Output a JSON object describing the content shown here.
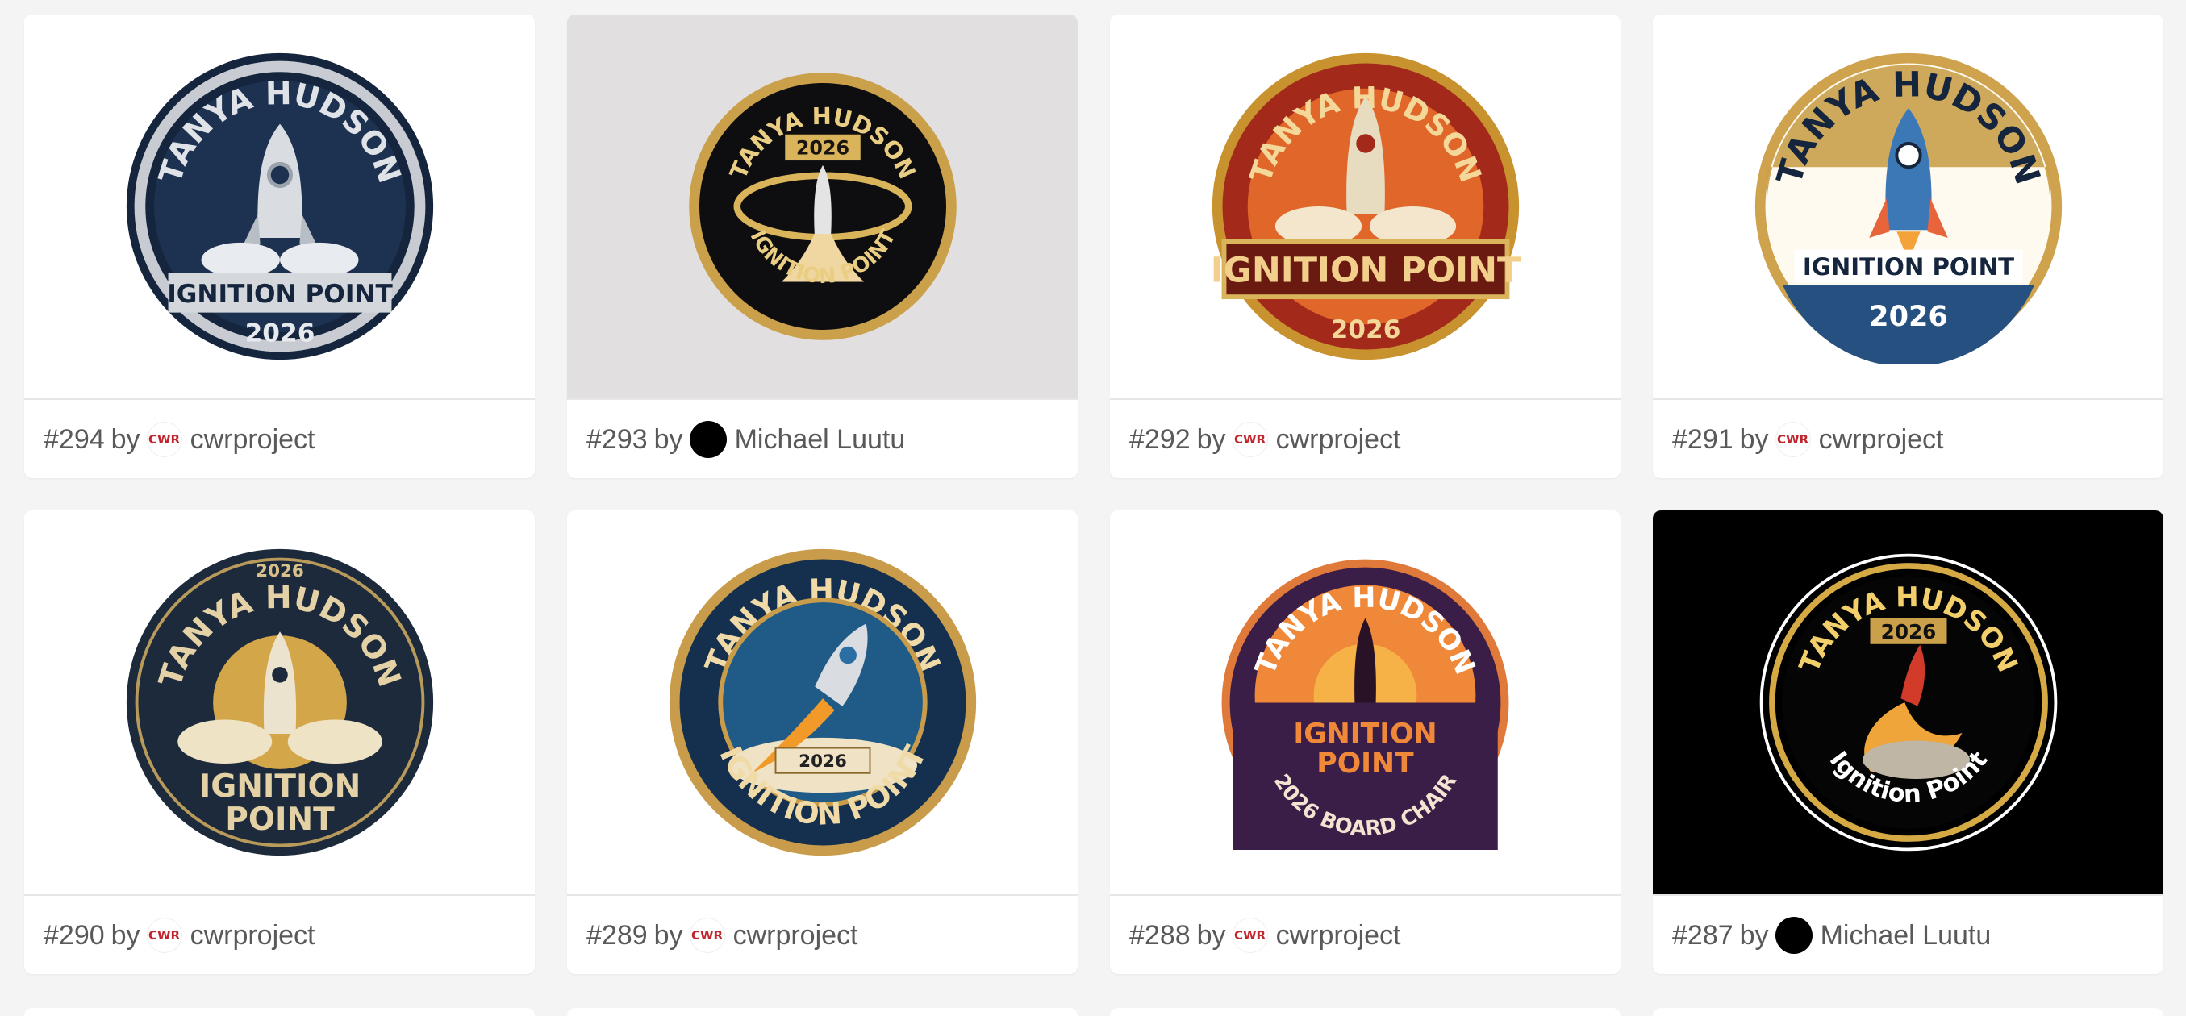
{
  "cards": [
    {
      "id": "#294",
      "by": "by",
      "author": "cwrproject",
      "avatar": "cwr-logo-icon",
      "badge_top": "TANYA HUDSON",
      "badge_banner": "IGNITION POINT",
      "badge_year": "2026"
    },
    {
      "id": "#293",
      "by": "by",
      "author": "Michael Luutu",
      "avatar": "black-avatar",
      "badge_top": "TANYA HUDSON",
      "badge_banner": "IGNITION POINT",
      "badge_year": "2026"
    },
    {
      "id": "#292",
      "by": "by",
      "author": "cwrproject",
      "avatar": "cwr-logo-icon",
      "badge_top": "TANYA HUDSON",
      "badge_banner": "IGNITION POINT",
      "badge_year": "2026"
    },
    {
      "id": "#291",
      "by": "by",
      "author": "cwrproject",
      "avatar": "cwr-logo-icon",
      "badge_top": "TANYA HUDSON",
      "badge_banner": "IGNITION POINT",
      "badge_year": "2026"
    },
    {
      "id": "#290",
      "by": "by",
      "author": "cwrproject",
      "avatar": "cwr-logo-icon",
      "badge_top": "TANYA HUDSON",
      "badge_banner": "IGNITION",
      "badge_banner2": "POINT",
      "badge_year": "2026"
    },
    {
      "id": "#289",
      "by": "by",
      "author": "cwrproject",
      "avatar": "cwr-logo-icon",
      "badge_top": "TANYA HUDSON",
      "badge_banner": "IGNITION POINT",
      "badge_year": "2026"
    },
    {
      "id": "#288",
      "by": "by",
      "author": "cwrproject",
      "avatar": "cwr-logo-icon",
      "badge_top": "TANYA HUDSON",
      "badge_banner": "IGNITION",
      "badge_banner2": "POINT",
      "badge_year": "2026 BOARD CHAIR"
    },
    {
      "id": "#287",
      "by": "by",
      "author": "Michael Luutu",
      "avatar": "black-avatar",
      "badge_top": "TANYA HUDSON",
      "badge_banner": "Ignition Point",
      "badge_year": "2026"
    }
  ],
  "avatar_text": "CWR",
  "colors": {
    "page_bg": "#f4f4f4",
    "card_bg": "#ffffff",
    "meta_text": "#595959",
    "gold": "#c9a24a",
    "navy": "#14253d"
  }
}
